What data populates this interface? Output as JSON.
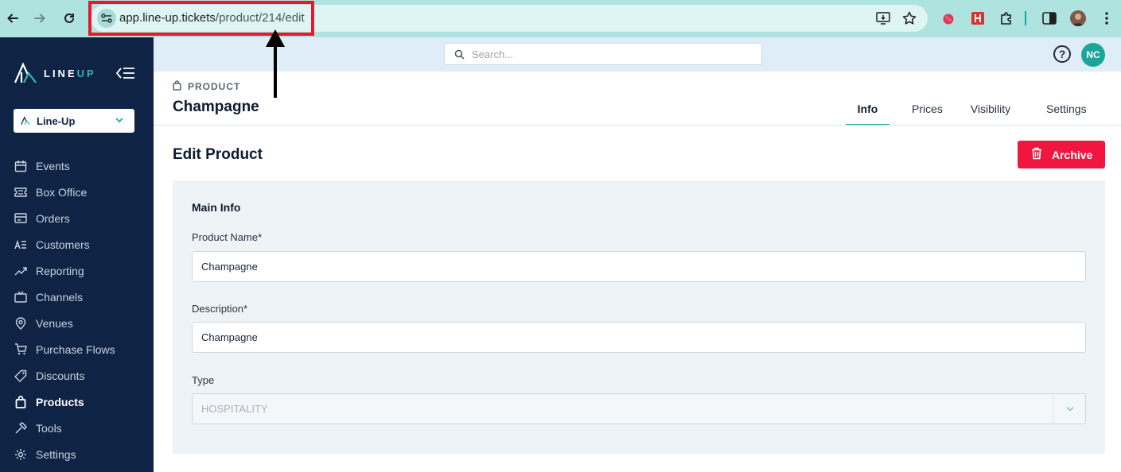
{
  "browser": {
    "url_host": "app.line-up.tickets",
    "url_path": "/product/214/edit"
  },
  "sidebar": {
    "logo_text_main": "LINE",
    "logo_text_accent": "UP",
    "org_selector": "Line-Up",
    "items": [
      {
        "label": "Events",
        "icon": "calendar-icon"
      },
      {
        "label": "Box Office",
        "icon": "ticket-icon"
      },
      {
        "label": "Orders",
        "icon": "card-icon"
      },
      {
        "label": "Customers",
        "icon": "customers-list-icon"
      },
      {
        "label": "Reporting",
        "icon": "trend-chart-icon"
      },
      {
        "label": "Channels",
        "icon": "tv-icon"
      },
      {
        "label": "Venues",
        "icon": "map-pin-icon"
      },
      {
        "label": "Purchase Flows",
        "icon": "cart-icon"
      },
      {
        "label": "Discounts",
        "icon": "tag-icon"
      },
      {
        "label": "Products",
        "icon": "bag-icon"
      },
      {
        "label": "Tools",
        "icon": "hammer-icon"
      },
      {
        "label": "Settings",
        "icon": "gear-icon"
      }
    ],
    "active_item": "Products"
  },
  "topbar": {
    "search_placeholder": "Search...",
    "help_label": "?",
    "user_initials": "NC"
  },
  "header": {
    "eyebrow": "PRODUCT",
    "title": "Champagne",
    "tabs": [
      "Info",
      "Prices",
      "Visibility",
      "Settings"
    ],
    "active_tab": "Info"
  },
  "edit": {
    "section_title": "Edit Product",
    "archive_label": "Archive",
    "card_title": "Main Info",
    "product_name_label": "Product Name*",
    "product_name_value": "Champagne",
    "description_label": "Description*",
    "description_value": "Champagne",
    "type_label": "Type",
    "type_value": "HOSPITALITY"
  },
  "colors": {
    "sidebar_bg": "#0f2344",
    "accent_teal": "#1aa79a",
    "archive_red": "#f0163f",
    "highlight_red": "#e8192c"
  }
}
